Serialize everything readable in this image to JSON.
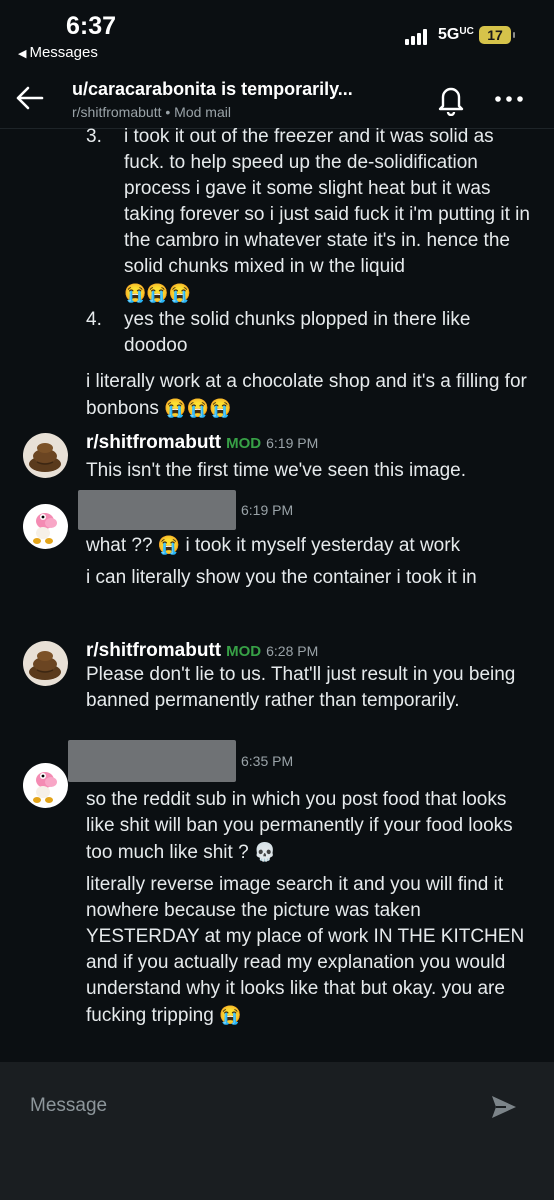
{
  "status_bar": {
    "time": "6:37",
    "back_app": "Messages",
    "network": "5G",
    "network_suffix": "UC",
    "battery": "17"
  },
  "header": {
    "title": "u/caracarabonita is temporarily...",
    "subreddit": "r/shitfromabutt",
    "separator": "•",
    "mode": "Mod mail",
    "icons": [
      "back-arrow-icon",
      "bell-icon",
      "more-icon"
    ]
  },
  "continued_message": {
    "item3_num": "3.",
    "item3_text": "i took it out of the freezer and it was solid as fuck. to help speed up the de-solidification process i gave it some slight heat but it was taking forever so i just said fuck it i'm putting it in the cambro in whatever state it's in. hence the solid chunks mixed in w the liquid",
    "item3_emoji": "😭😭😭",
    "item4_num": "4.",
    "item4_text": "yes the solid chunks plopped in there like doodoo",
    "para": "i literally work at a chocolate shop and it's a filling for bonbons",
    "para_emoji": "😭😭😭"
  },
  "messages": [
    {
      "author": "r/shitfromabutt",
      "badge": "MOD",
      "time": "6:19 PM",
      "lines": [
        "This isn't the first time we've seen this image."
      ]
    },
    {
      "author": "",
      "time": "6:19 PM",
      "line1": "what ??",
      "line1_emoji": "😭",
      "line1_rest": "i took it myself yesterday at work",
      "line2": "i can literally show you the container i took it in"
    },
    {
      "author": "r/shitfromabutt",
      "badge": "MOD",
      "time": "6:28 PM",
      "lines": [
        "Please don't lie to us. That'll just result in you being banned permanently rather than temporarily."
      ]
    },
    {
      "author": "",
      "time": "6:35 PM",
      "line1": "so the reddit sub in which you post food that looks like shit will ban you permanently if your food looks too much like shit ?",
      "line1_emoji": "💀",
      "line2": "literally reverse image search it and you will find it nowhere because the picture was taken YESTERDAY at my place of work IN THE KITCHEN and if you actually read my explanation you would understand why it looks like that but okay. you are fucking tripping",
      "line2_emoji": "😭"
    }
  ],
  "composer": {
    "placeholder": "Message"
  },
  "colors": {
    "background": "#0b0f12",
    "mod_badge": "#37a046",
    "composer": "#1a1e21"
  }
}
